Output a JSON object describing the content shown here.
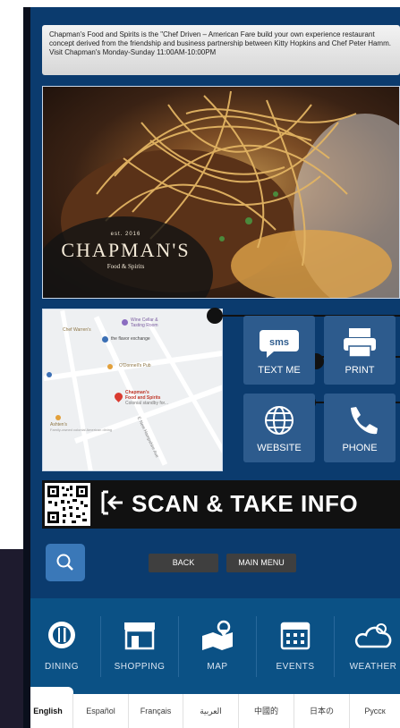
{
  "description": {
    "line1": "Chapman's Food and Spirits is the \"Chef Driven – American Fare build your own experience restaurant",
    "line2": "concept derived from the friendship and business partnership between Kitty Hopkins and Chef Peter Hamm.",
    "line3": "Visit Chapman's Monday-Sunday 11:00AM-10:00PM"
  },
  "hero": {
    "logo_est": "est. 2016",
    "logo_name": "CHAPMAN'S",
    "logo_sub": "Food & Spirits"
  },
  "map": {
    "labels": {
      "wine_cellar": "Wine Cellar &",
      "tasting_room": "Tasting Room",
      "chef_warrens": "Chef Warren's",
      "flavor_exchange": "the flavor exchange",
      "odonnells": "O'Donnell's Pub",
      "chapmans_1": "Chapman's",
      "chapmans_2": "Food and Spirits",
      "chapmans_3": "Colonial standby for...",
      "ashtens": "Ashten's",
      "ashtens_desc": "Family-owned colonial American dining",
      "street_ne": "E New Hampshire Ave"
    }
  },
  "tiles": {
    "sms_icon_text": "sms",
    "text_me": "TEXT ME",
    "print": "PRINT",
    "website": "WEBSITE",
    "phone": "PHONE"
  },
  "scan": {
    "label": "SCAN & TAKE INFO"
  },
  "controls": {
    "back": "BACK",
    "main_menu": "MAIN MENU"
  },
  "nav": {
    "items": [
      {
        "label": "DINING",
        "icon": "dining-icon"
      },
      {
        "label": "SHOPPING",
        "icon": "shopping-icon"
      },
      {
        "label": "MAP",
        "icon": "map-icon"
      },
      {
        "label": "EVENTS",
        "icon": "events-icon"
      },
      {
        "label": "WEATHER",
        "icon": "weather-icon"
      }
    ]
  },
  "languages": [
    "English",
    "Español",
    "Français",
    "العربية",
    "中國的",
    "日本の",
    "Русск"
  ],
  "colors": {
    "kiosk_background": "#0b3b6e",
    "tile": "#2d5b8d",
    "nav": "#0b5185",
    "search": "#3a78b8"
  }
}
